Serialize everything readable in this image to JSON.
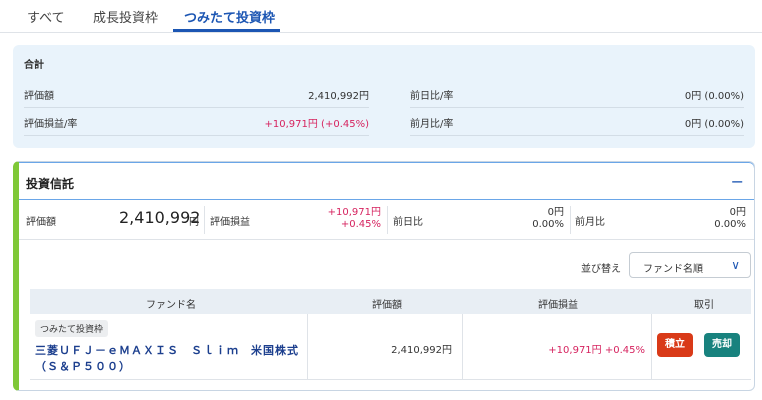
{
  "tabs": [
    {
      "label": "すべて"
    },
    {
      "label": "成長投資枠"
    },
    {
      "label": "つみたて投資枠"
    }
  ],
  "summary": {
    "title": "合計",
    "valuation_label": "評価額",
    "valuation_value": "2,410,992円",
    "day_change_label": "前日比/率",
    "day_change_value": "0円 (0.00%)",
    "pnl_label": "評価損益/率",
    "pnl_value": "+10,971円 (+0.45%)",
    "month_change_label": "前月比/率",
    "month_change_value": "0円 (0.00%)"
  },
  "fund_card": {
    "title": "投資信託",
    "collapse_symbol": "−",
    "valuation_label": "評価額",
    "valuation_value": "2,410,992",
    "valuation_unit": "円",
    "pnl_label": "評価損益",
    "pnl_amount": "+10,971円",
    "pnl_rate": "+0.45%",
    "day_label": "前日比",
    "day_amount": "0円",
    "day_rate": "0.00%",
    "month_label": "前月比",
    "month_amount": "0円",
    "month_rate": "0.00%",
    "sort_label": "並び替え",
    "sort_value": "ファンド名順"
  },
  "table": {
    "headers": [
      "ファンド名",
      "評価額",
      "評価損益",
      "取引"
    ],
    "rows": [
      {
        "tag": "つみたて投資枠",
        "name": "三菱ＵＦＪ－ｅＭＡＸＩＳ　Ｓｌｉｍ　米国株式（Ｓ＆Ｐ５００）",
        "valuation": "2,410,992円",
        "pnl": "+10,971円 +0.45%",
        "buy_label": "積立",
        "sell_label": "売却"
      }
    ]
  },
  "colors": {
    "accent": "#1c56b3",
    "positive": "#d6235f",
    "buy": "#d93a18",
    "sell": "#18827e",
    "card_stripe": "#7fc837"
  }
}
